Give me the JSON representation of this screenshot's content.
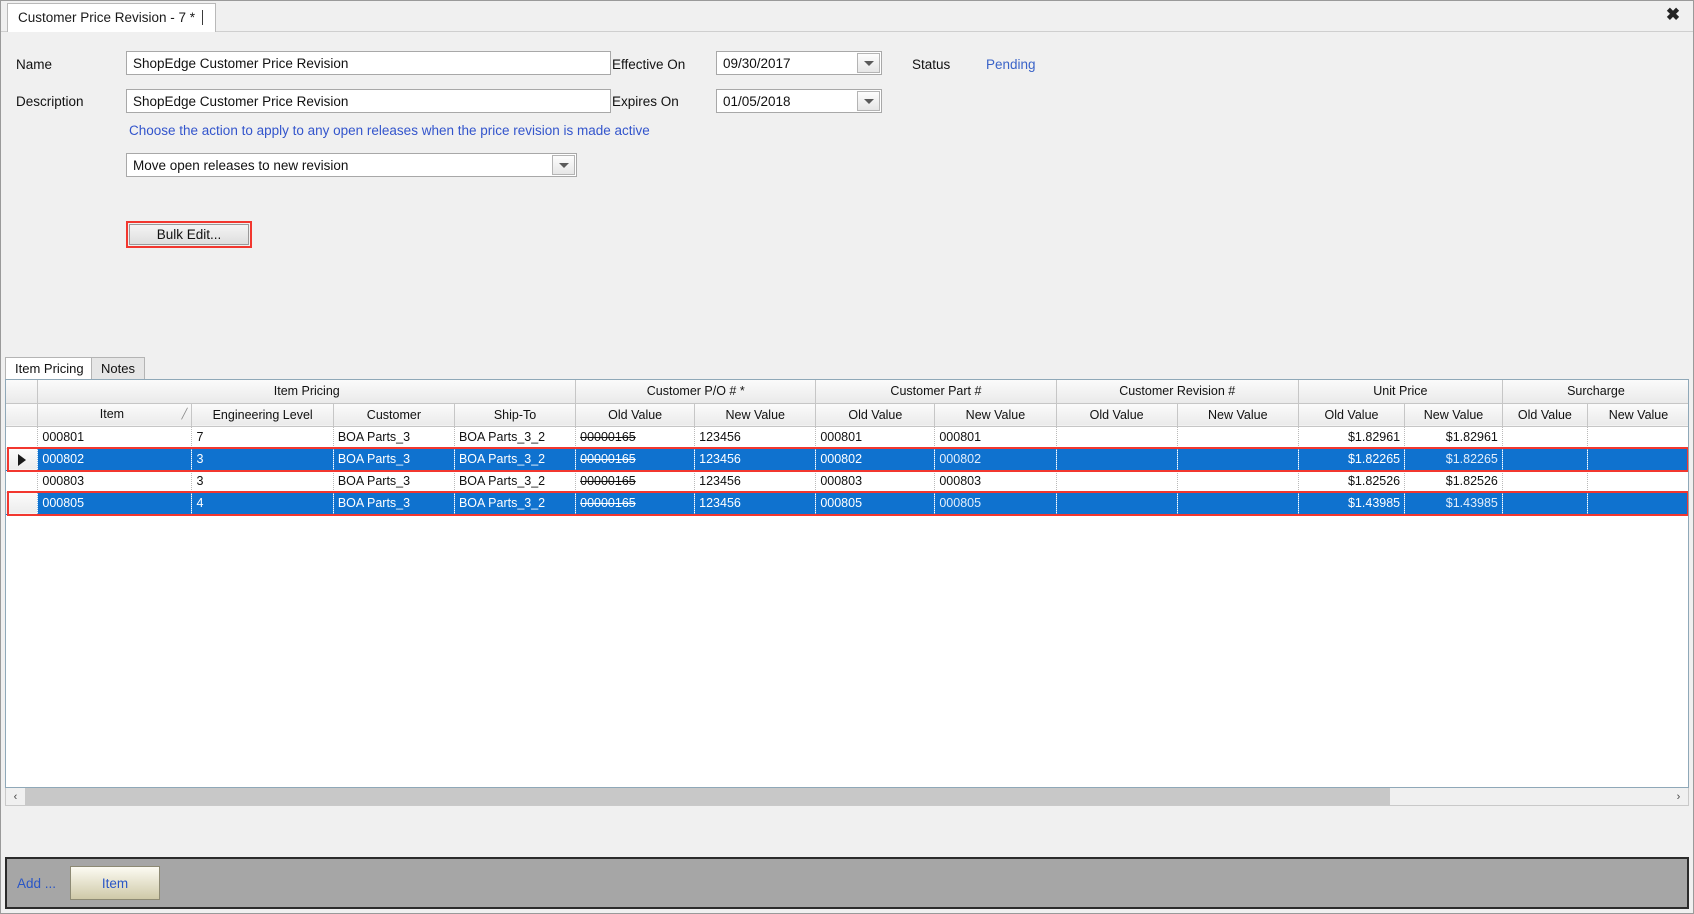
{
  "window": {
    "tab_title": "Customer Price Revision - 7 *",
    "close_label": "✖"
  },
  "form": {
    "name_label": "Name",
    "name_value": "ShopEdge Customer Price Revision",
    "description_label": "Description",
    "description_value": "ShopEdge Customer Price Revision",
    "effective_on_label": "Effective On",
    "effective_on_value": "09/30/2017",
    "expires_on_label": "Expires On",
    "expires_on_value": "01/05/2018",
    "status_label": "Status",
    "status_value": "Pending",
    "hint_text": "Choose the action to apply to any open releases when the price revision is made active",
    "action_value": "Move open releases to new revision",
    "bulk_edit_label": "Bulk Edit..."
  },
  "tabs": [
    {
      "label": "Item Pricing",
      "active": true
    },
    {
      "label": "Notes",
      "active": false
    }
  ],
  "grid": {
    "group_headers": [
      {
        "label": "Item Pricing",
        "span": 4
      },
      {
        "label": "Customer P/O # *",
        "span": 2
      },
      {
        "label": "Customer Part #",
        "span": 2
      },
      {
        "label": "Customer Revision #",
        "span": 2
      },
      {
        "label": "Unit Price",
        "span": 2
      },
      {
        "label": "Surcharge",
        "span": 2
      }
    ],
    "columns": [
      {
        "label": "Item",
        "sort": "╱"
      },
      {
        "label": "Engineering Level"
      },
      {
        "label": "Customer"
      },
      {
        "label": "Ship-To"
      },
      {
        "label": "Old Value"
      },
      {
        "label": "New Value"
      },
      {
        "label": "Old Value"
      },
      {
        "label": "New Value"
      },
      {
        "label": "Old Value"
      },
      {
        "label": "New Value"
      },
      {
        "label": "Old Value"
      },
      {
        "label": "New Value"
      },
      {
        "label": "Old Value"
      },
      {
        "label": "New Value"
      }
    ],
    "rows": [
      {
        "selected": false,
        "indicator": "",
        "item": "000801",
        "engineering_level": "7",
        "customer": "BOA Parts_3",
        "ship_to": "BOA Parts_3_2",
        "po_old": "00000165",
        "po_new": "123456",
        "part_old": "000801",
        "part_new": "000801",
        "rev_old": "",
        "rev_new": "",
        "price_old": "$1.82961",
        "price_new": "$1.82961",
        "sur_old": "",
        "sur_new": ""
      },
      {
        "selected": true,
        "indicator": "▶",
        "item": "000802",
        "engineering_level": "3",
        "customer": "BOA Parts_3",
        "ship_to": "BOA Parts_3_2",
        "po_old": "00000165",
        "po_new": "123456",
        "part_old": "000802",
        "part_new": "000802",
        "rev_old": "",
        "rev_new": "",
        "price_old": "$1.82265",
        "price_new": "$1.82265",
        "sur_old": "",
        "sur_new": ""
      },
      {
        "selected": false,
        "indicator": "",
        "item": "000803",
        "engineering_level": "3",
        "customer": "BOA Parts_3",
        "ship_to": "BOA Parts_3_2",
        "po_old": "00000165",
        "po_new": "123456",
        "part_old": "000803",
        "part_new": "000803",
        "rev_old": "",
        "rev_new": "",
        "price_old": "$1.82526",
        "price_new": "$1.82526",
        "sur_old": "",
        "sur_new": ""
      },
      {
        "selected": true,
        "indicator": "",
        "item": "000805",
        "engineering_level": "4",
        "customer": "BOA Parts_3",
        "ship_to": "BOA Parts_3_2",
        "po_old": "00000165",
        "po_new": "123456",
        "part_old": "000805",
        "part_new": "000805",
        "rev_old": "",
        "rev_new": "",
        "price_old": "$1.43985",
        "price_new": "$1.43985",
        "sur_old": "",
        "sur_new": ""
      }
    ]
  },
  "scrollbar": {
    "left_arrow": "‹",
    "right_arrow": "›"
  },
  "footer": {
    "add_label": "Add ...",
    "item_label": "Item"
  },
  "colors": {
    "selection_blue": "#0f72cf",
    "highlight_red": "#f2372f",
    "new_value_bg": "#fdf3dc",
    "link_blue": "#3355cc"
  }
}
